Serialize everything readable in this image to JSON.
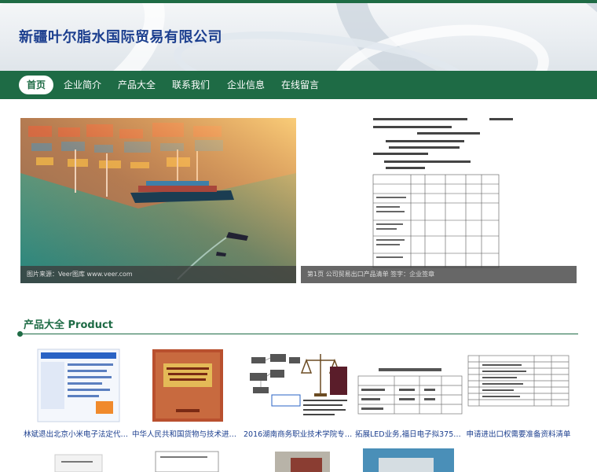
{
  "site": {
    "title": "新疆叶尔脂水国际贸易有限公司",
    "colors": {
      "brand_green": "#1e6b45",
      "title_blue": "#1c3f8f"
    }
  },
  "nav": {
    "items": [
      {
        "label": "首页",
        "active": true
      },
      {
        "label": "企业简介",
        "active": false
      },
      {
        "label": "产品大全",
        "active": false
      },
      {
        "label": "联系我们",
        "active": false
      },
      {
        "label": "企业信息",
        "active": false
      },
      {
        "label": "在线留言",
        "active": false
      }
    ]
  },
  "banner": {
    "left_caption": "图片来源：Veer图库 www.veer.com",
    "right_caption": "第1页 公司贸易出口产品清单 签字：企业签章"
  },
  "products_section": {
    "title": "产品大全 Product",
    "items": [
      {
        "name": "林斌退出北京小米电子法定代表人...",
        "icon": "web-screenshot-thumb"
      },
      {
        "name": "中华人民共和国货物与技术进出口...",
        "icon": "book-cover-thumb"
      },
      {
        "name": "2016湖南商务职业技术学院专业...",
        "icon": "law-scale-thumb"
      },
      {
        "name": "拓展LED业务,福日电子拟3750万...",
        "icon": "table-thumb"
      },
      {
        "name": "申请进出口权需要准备资料清单",
        "icon": "form-thumb"
      }
    ]
  }
}
